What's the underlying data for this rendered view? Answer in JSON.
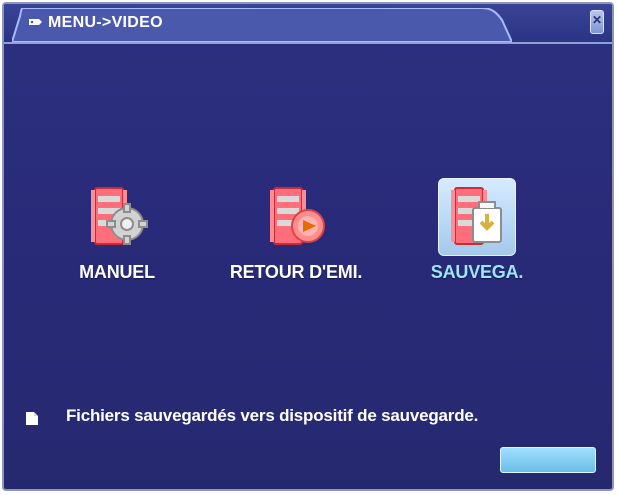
{
  "window": {
    "title": "MENU->VIDEO"
  },
  "tiles": [
    {
      "label": "MANUEL",
      "icon": "gear-icon"
    },
    {
      "label": "RETOUR D'EMI.",
      "icon": "playback-icon"
    },
    {
      "label": "SAUVEGA.",
      "icon": "backup-icon",
      "selected": true
    }
  ],
  "hint": {
    "text": "Fichiers sauvegardés vers dispositif de sauvegarde."
  },
  "colors": {
    "background": "#2a2c7b",
    "title_tab": "#3f4fa5",
    "selected_label": "#9fe6ff",
    "button": "#8fd6ff"
  }
}
